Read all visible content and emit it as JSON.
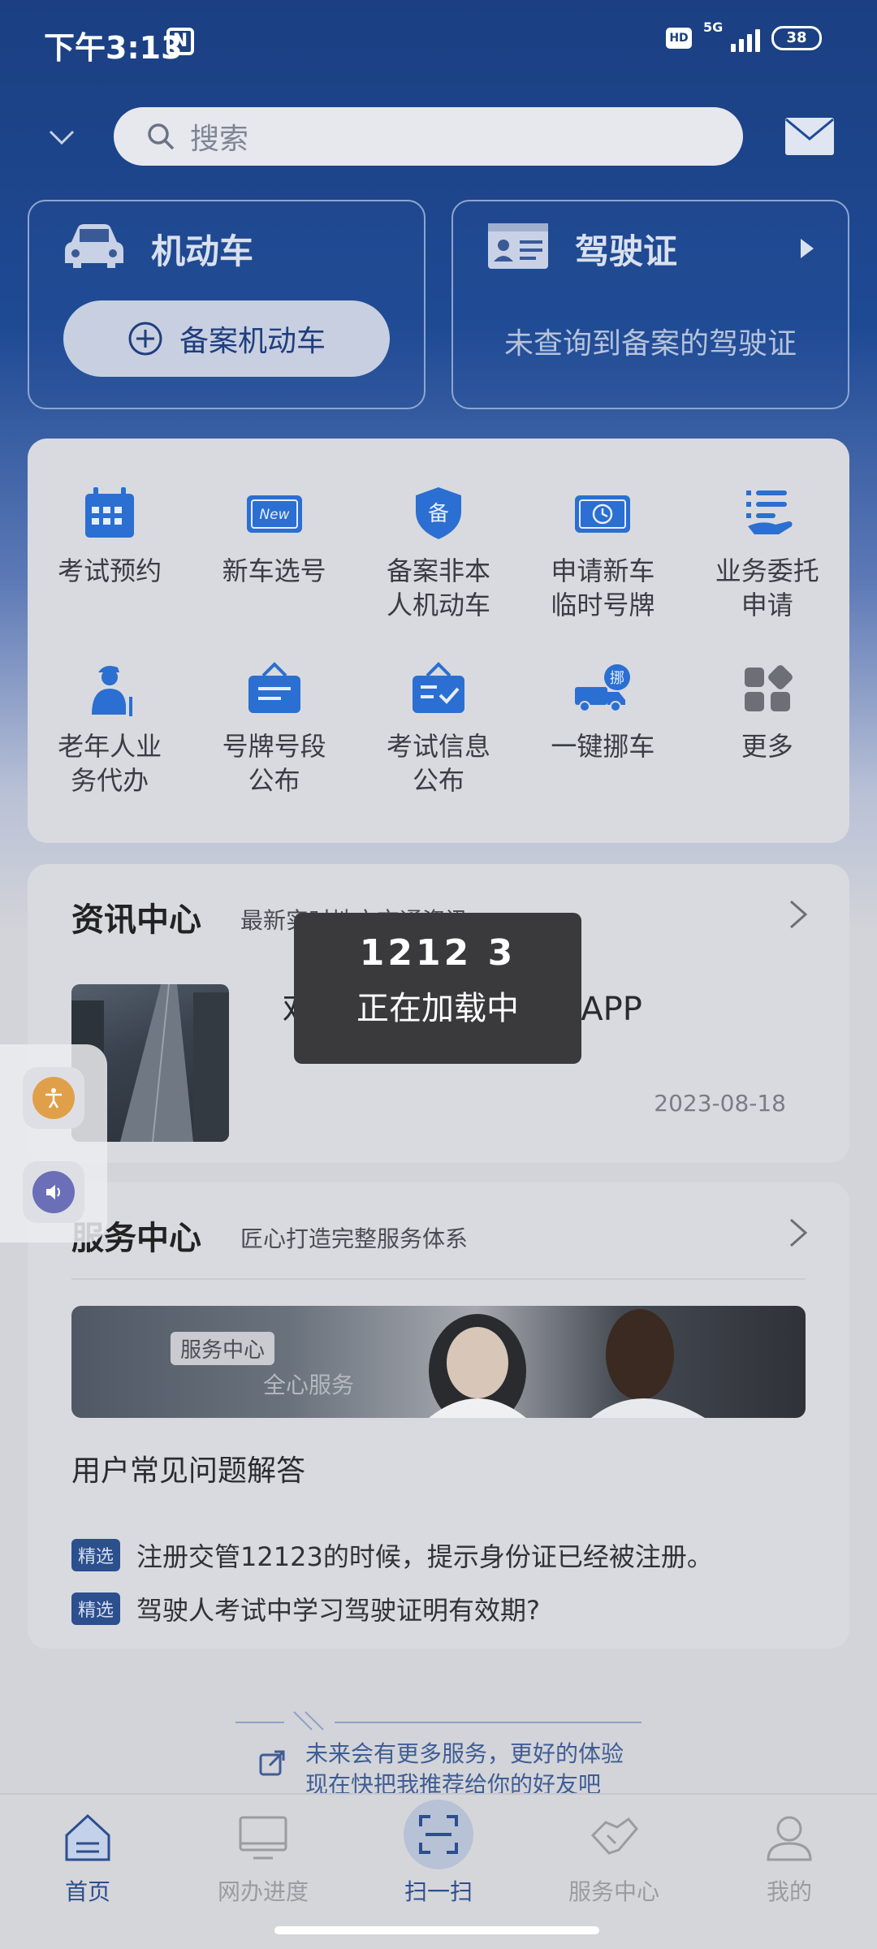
{
  "status_bar": {
    "time": "下午3:13",
    "nfc": "N",
    "hd": "HD",
    "network": "5G",
    "battery": "38"
  },
  "header": {
    "search_placeholder": "搜索"
  },
  "vehicle_card": {
    "title": "机动车",
    "register_button": "备案机动车"
  },
  "license_card": {
    "title": "驾驶证",
    "message": "未查询到备案的驾驶证"
  },
  "services": [
    {
      "label": "考试预约",
      "icon": "calendar-icon"
    },
    {
      "label": "新车选号",
      "icon": "new-plate-icon"
    },
    {
      "label": "备案非本\n人机动车",
      "icon": "shield-icon"
    },
    {
      "label": "申请新车\n临时号牌",
      "icon": "temp-plate-icon"
    },
    {
      "label": "业务委托\n申请",
      "icon": "delegate-icon"
    },
    {
      "label": "老年人业\n务代办",
      "icon": "elder-icon"
    },
    {
      "label": "号牌号段\n公布",
      "icon": "plate-board-icon"
    },
    {
      "label": "考试信息\n公布",
      "icon": "exam-board-icon"
    },
    {
      "label": "一键挪车",
      "icon": "move-car-icon"
    },
    {
      "label": "更多",
      "icon": "more-grid-icon"
    }
  ],
  "news": {
    "title": "资讯中心",
    "subtitle": "最新实时地方交通资讯",
    "item_title": "欢迎使用交管12123APP",
    "item_date": "2023-08-18"
  },
  "service_center": {
    "title": "服务中心",
    "subtitle": "匠心打造完整服务体系",
    "banner_tag": "服务中心",
    "banner_slogan": "全心服务",
    "faq_title": "用户常见问题解答",
    "faq": [
      {
        "tag": "精选",
        "text": "注册交管12123的时候，提示身份证已经被注册。"
      },
      {
        "tag": "精选",
        "text": "驾驶人考试中学习驾驶证明有效期?"
      }
    ]
  },
  "promo": {
    "line1": "未来会有更多服务，更好的体验",
    "line2": "现在快把我推荐给你的好友吧"
  },
  "toast": {
    "line1": "1212 3",
    "line2": "正在加载中"
  },
  "bottom_nav": [
    {
      "label": "首页",
      "icon": "home-icon",
      "active": true
    },
    {
      "label": "网办进度",
      "icon": "monitor-icon",
      "active": false
    },
    {
      "label": "扫一扫",
      "icon": "scan-icon",
      "active": false
    },
    {
      "label": "服务中心",
      "icon": "handshake-icon",
      "active": false
    },
    {
      "label": "我的",
      "icon": "user-icon",
      "active": false
    }
  ],
  "colors": {
    "brand_blue": "#1b3f82",
    "icon_blue": "#2a6fd1",
    "tag_blue": "#2c4f8e"
  }
}
